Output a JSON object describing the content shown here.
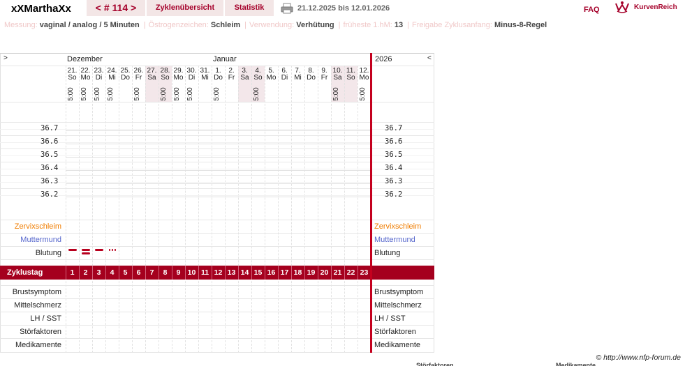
{
  "header": {
    "username": "xXMarthaXx",
    "cycle_nav": "< # 114 >",
    "cycle_overview": "Zyklenübersicht",
    "statistics": "Statistik",
    "date_range": "21.12.2025 bis 12.01.2026",
    "faq": "FAQ",
    "logo_text": "KurvenReich"
  },
  "info": [
    {
      "key": "Messung:",
      "value": "vaginal / analog / 5 Minuten"
    },
    {
      "key": "Östrogenzeichen:",
      "value": "Schleim"
    },
    {
      "key": "Verwendung:",
      "value": "Verhütung"
    },
    {
      "key": "früheste 1.hM:",
      "value": "13"
    },
    {
      "key": "Freigabe Zyklusanfang:",
      "value": "Minus-8-Regel"
    }
  ],
  "chart": {
    "nav_left": ">",
    "nav_right": "<",
    "month_dec": "Dezember",
    "month_jan": "Januar",
    "year": "2026",
    "days": [
      {
        "date": "21.",
        "dow": "So",
        "time": "5:00",
        "weekend": false
      },
      {
        "date": "22.",
        "dow": "Mo",
        "time": "5:00",
        "weekend": false
      },
      {
        "date": "23.",
        "dow": "Di",
        "time": "5:00",
        "weekend": false
      },
      {
        "date": "24.",
        "dow": "Mi",
        "time": "5:00",
        "weekend": false
      },
      {
        "date": "25.",
        "dow": "Do",
        "time": "",
        "weekend": false
      },
      {
        "date": "26.",
        "dow": "Fr",
        "time": "5:00",
        "weekend": false
      },
      {
        "date": "27.",
        "dow": "Sa",
        "time": "",
        "weekend": true
      },
      {
        "date": "28.",
        "dow": "So",
        "time": "5:00",
        "weekend": true
      },
      {
        "date": "29.",
        "dow": "Mo",
        "time": "5:00",
        "weekend": false
      },
      {
        "date": "30.",
        "dow": "Di",
        "time": "5:00",
        "weekend": false
      },
      {
        "date": "31.",
        "dow": "Mi",
        "time": "",
        "weekend": false
      },
      {
        "date": "1.",
        "dow": "Do",
        "time": "5:00",
        "weekend": false
      },
      {
        "date": "2.",
        "dow": "Fr",
        "time": "",
        "weekend": false
      },
      {
        "date": "3.",
        "dow": "Sa",
        "time": "",
        "weekend": true
      },
      {
        "date": "4.",
        "dow": "So",
        "time": "5:00",
        "weekend": true
      },
      {
        "date": "5.",
        "dow": "Mo",
        "time": "",
        "weekend": false
      },
      {
        "date": "6.",
        "dow": "Di",
        "time": "",
        "weekend": false
      },
      {
        "date": "7.",
        "dow": "Mi",
        "time": "",
        "weekend": false
      },
      {
        "date": "8.",
        "dow": "Do",
        "time": "",
        "weekend": false
      },
      {
        "date": "9.",
        "dow": "Fr",
        "time": "",
        "weekend": false
      },
      {
        "date": "10.",
        "dow": "Sa",
        "time": "5:00",
        "weekend": true
      },
      {
        "date": "11.",
        "dow": "So",
        "time": "",
        "weekend": true
      },
      {
        "date": "12.",
        "dow": "Mo",
        "time": "5:00",
        "weekend": false
      }
    ],
    "temperatures": [
      "36.7",
      "36.6",
      "36.5",
      "36.4",
      "36.3",
      "36.2"
    ],
    "rows_top": [
      {
        "label": "Zervixschleim",
        "color": "#f07d00"
      },
      {
        "label": "Muttermund",
        "color": "#5566cc"
      },
      {
        "label": "Blutung",
        "color": "#222222"
      }
    ],
    "bleeding": [
      "heavy",
      "heavy",
      "medium",
      "spotting"
    ],
    "cycleday_label": "Zyklustag",
    "cycle_days": [
      "1",
      "2",
      "3",
      "4",
      "5",
      "6",
      "7",
      "8",
      "9",
      "10",
      "11",
      "12",
      "13",
      "14",
      "15",
      "16",
      "17",
      "18",
      "19",
      "20",
      "21",
      "22",
      "23"
    ],
    "rows_bottom": [
      "Brustsymptom",
      "Mittelschmerz",
      "LH / SST",
      "Störfaktoren",
      "Medikamente"
    ]
  },
  "footer": {
    "copyright": "© http://www.nfp-forum.de",
    "cutoff_left": "Störfaktoren",
    "cutoff_right": "Medikamente"
  },
  "colors": {
    "brand": "#a5002a",
    "accent_line": "#c4001e",
    "weekend_bg": "#f3e7ea"
  }
}
